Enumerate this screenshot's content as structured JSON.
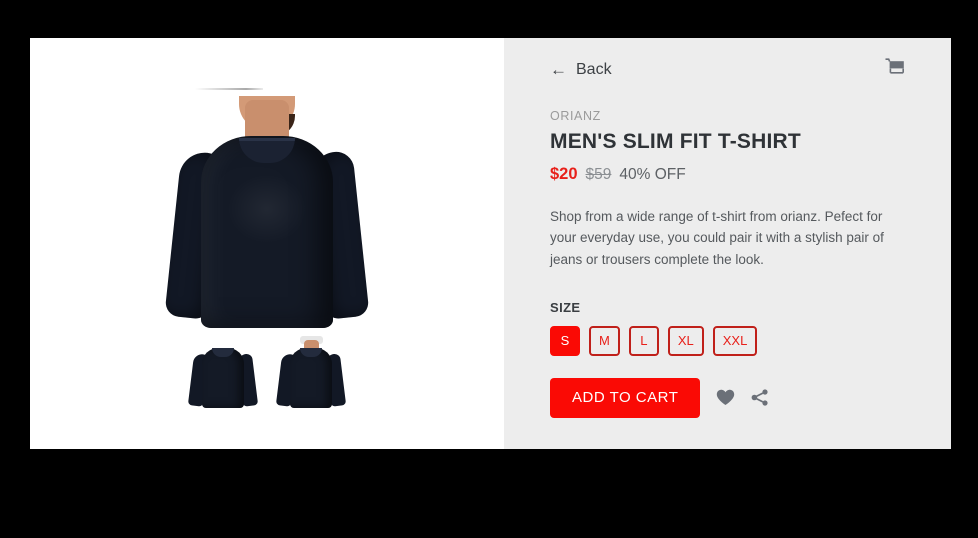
{
  "window": {
    "background_color": "#000000",
    "card_background": "#ffffff",
    "details_background": "#ededed"
  },
  "nav": {
    "back_label": "Back",
    "back_arrow_glyph": "←",
    "cart_icon_name": "shopping-cart-icon"
  },
  "product": {
    "brand": "ORIANZ",
    "title": "MEN'S SLIM FIT T-SHIRT",
    "price_current": "$20",
    "price_original": "$59",
    "discount": "40% OFF",
    "description": "Shop from a wide range of t-shirt from orianz. Pefect for your everyday use, you could pair it with a stylish pair of jeans or trousers complete the look.",
    "accent_color": "#fa0a05",
    "price_color": "#e8201a"
  },
  "size": {
    "label": "SIZE",
    "options": [
      {
        "label": "S",
        "selected": true
      },
      {
        "label": "M",
        "selected": false
      },
      {
        "label": "L",
        "selected": false
      },
      {
        "label": "XL",
        "selected": false
      },
      {
        "label": "XXL",
        "selected": false
      }
    ]
  },
  "actions": {
    "add_to_cart_label": "ADD TO CART",
    "wishlist_icon_name": "heart-icon",
    "share_icon_name": "share-icon",
    "icon_color": "#6b7078"
  },
  "gallery": {
    "thumbnails": [
      {
        "view": "back"
      },
      {
        "view": "front"
      }
    ]
  }
}
